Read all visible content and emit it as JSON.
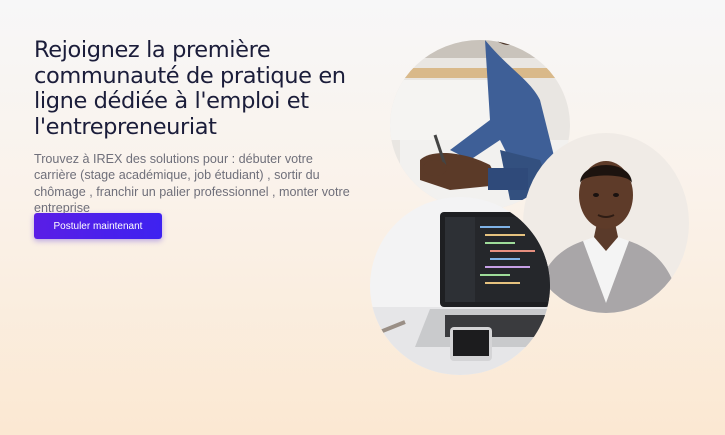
{
  "hero": {
    "title": "Rejoignez la première communauté de pratique en ligne dédiée à l'emploi et l'entrepreneuriat",
    "description": "Trouvez à IREX des solutions pour : débuter votre carrière (stage académique, job étudiant) , sortir du chômage , franchir un palier professionnel , monter votre entreprise",
    "cta_label": "Postuler maintenant"
  },
  "images": [
    "person-writing-photo",
    "portrait-man-photo",
    "laptop-code-photo"
  ],
  "colors": {
    "accent": "#4a22ec",
    "title": "#1b1d3a",
    "text": "#6f6f7a"
  }
}
